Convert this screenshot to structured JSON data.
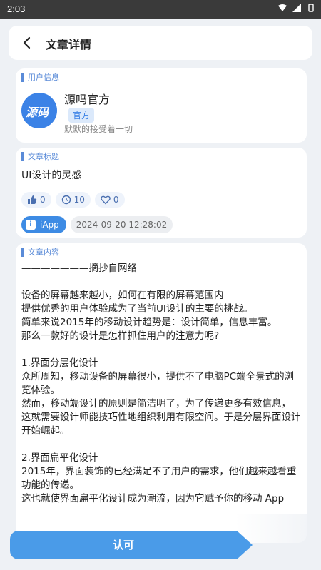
{
  "status_bar": {
    "time": "2:03",
    "icons": [
      "wifi-icon",
      "signal-icon",
      "battery-icon"
    ]
  },
  "header": {
    "back_icon": "chevron-left-icon",
    "title": "文章详情"
  },
  "user_section": {
    "label": "用户信息",
    "avatar_text": "源码",
    "name": "源吗官方",
    "badge": "官方",
    "motto": "默默的接受着一切"
  },
  "title_section": {
    "label": "文章标题",
    "title": "UI设计的灵感",
    "likes": "0",
    "views": "10",
    "favorites": "0",
    "app_name": "iApp",
    "app_icon_glyph": "i",
    "date": "2024-09-20 12:28:02"
  },
  "content_section": {
    "label": "文章内容",
    "paragraphs": [
      "———————摘抄自网络",
      "",
      "设备的屏幕越来越小，如何在有限的屏幕范围内",
      "提供优秀的用户体验成为了当前UI设计的主要的挑战。",
      "简单来说2015年的移动设计趋势是：设计简单，信息丰富。",
      "那么一款好的设计是怎样抓住用户的注意力呢?",
      "",
      "1.界面分层化设计",
      "众所周知，移动设备的屏幕很小，提供不了电脑PC端全景式的浏览体验。",
      "然而，移动端设计的原则是简洁明了，为了传递更多有效信息，",
      "这就需要设计师能技巧性地组织利用有限空间。于是分层界面设计开始崛起。",
      "",
      "2.界面扁平化设计",
      "2015年，界面装饰的已经满足不了用户的需求，他们越来越看重功能的传递。",
      "这也就使界面扁平化设计成为潮流，因为它赋予你的移动 App"
    ]
  },
  "footer": {
    "approve_label": "认可"
  },
  "colors": {
    "accent": "#3d8be4",
    "background": "#eef1f5",
    "status_bar": "#3a3a3a"
  }
}
